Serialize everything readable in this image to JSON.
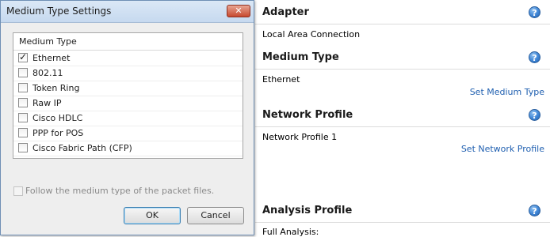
{
  "dialog": {
    "title": "Medium Type Settings",
    "close_label": "✕",
    "list_header": "Medium Type",
    "items": [
      {
        "label": "Ethernet",
        "checked": true
      },
      {
        "label": "802.11",
        "checked": false
      },
      {
        "label": "Token Ring",
        "checked": false
      },
      {
        "label": "Raw IP",
        "checked": false
      },
      {
        "label": "Cisco HDLC",
        "checked": false
      },
      {
        "label": "PPP for POS",
        "checked": false
      },
      {
        "label": "Cisco Fabric Path (CFP)",
        "checked": false
      }
    ],
    "follow_label": "Follow the medium type of the packet files.",
    "follow_checked": false,
    "ok_label": "OK",
    "cancel_label": "Cancel"
  },
  "panel": {
    "adapter_title": "Adapter",
    "adapter_value": "Local Area Connection",
    "medium_title": "Medium Type",
    "medium_value": "Ethernet",
    "medium_link": "Set Medium Type",
    "profile_title": "Network Profile",
    "profile_value": "Network Profile 1",
    "profile_link": "Set Network Profile",
    "analysis_title": "Analysis Profile",
    "analysis_value": "Full Analysis:",
    "help_glyph": "?"
  },
  "colors": {
    "link": "#1f5fb0",
    "help_icon": "#3f86d6",
    "close_button": "#c7492f"
  }
}
